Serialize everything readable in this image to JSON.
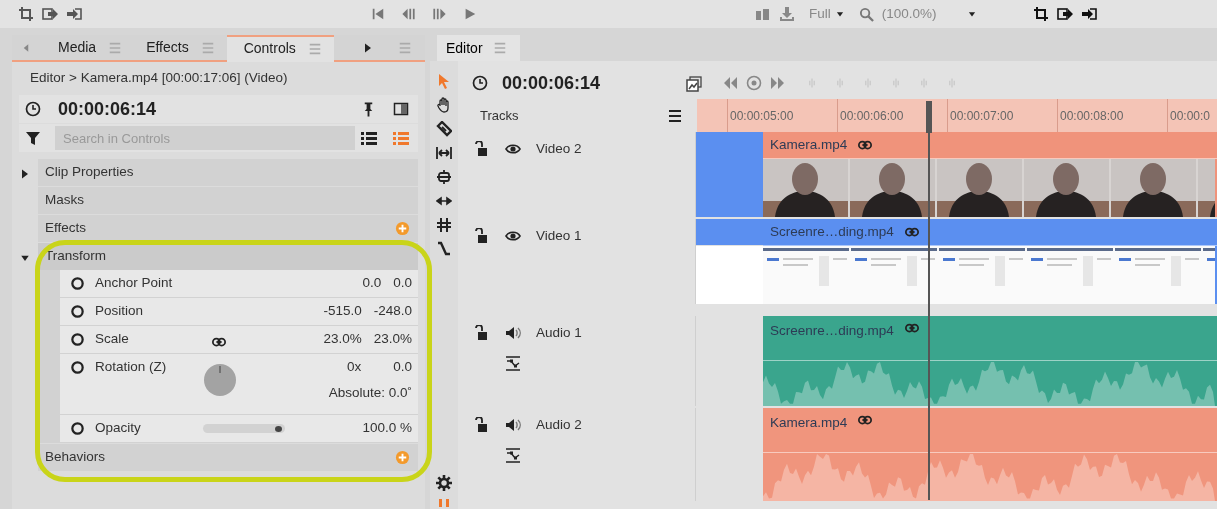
{
  "top_toolbar": {
    "quality": "Full",
    "zoom": "(100.0%)"
  },
  "panel_tabs": [
    {
      "label": "Media",
      "selected": false
    },
    {
      "label": "Effects",
      "selected": false
    },
    {
      "label": "Controls",
      "selected": true
    }
  ],
  "breadcrumb": "Editor > Kamera.mp4 [00:00:17:06] (Video)",
  "controls_time": "00:00:06:14",
  "search": {
    "placeholder": "Search in Controls"
  },
  "view_buttons": [
    {
      "selected": false
    },
    {
      "selected": true
    }
  ],
  "sections": [
    {
      "label": "Clip Properties",
      "kind": "group",
      "expanded": false,
      "add_button": false
    },
    {
      "label": "Masks",
      "kind": "item",
      "add_button": false
    },
    {
      "label": "Effects",
      "kind": "item",
      "add_button": true
    },
    {
      "label": "Transform",
      "kind": "group",
      "expanded": true,
      "add_button": false,
      "params": [
        {
          "label": "Anchor Point",
          "kind": "pair",
          "values": [
            "0.0",
            "0.0"
          ]
        },
        {
          "label": "Position",
          "kind": "pair",
          "values": [
            "-515.0",
            "-248.0"
          ]
        },
        {
          "label": "Scale",
          "kind": "pair",
          "linked": true,
          "values": [
            "23.0%",
            "23.0%"
          ]
        },
        {
          "label": "Rotation (Z)",
          "kind": "dial",
          "values": [
            "0x",
            "0.0"
          ],
          "absolute": "Absolute: 0.0˚"
        },
        {
          "label": "Opacity",
          "kind": "slider",
          "level": 1,
          "reading": "100.0 %"
        }
      ]
    },
    {
      "label": "Behaviors",
      "kind": "item",
      "add_button": true
    }
  ],
  "editor": {
    "tab": "Editor",
    "timecode": "00:00:06:14",
    "tracks_label": "Tracks",
    "ruler": [
      "00:00:05:00",
      "00:00:06:00",
      "00:00:07:00",
      "00:00:08:00",
      "00:00:0"
    ],
    "tracks": [
      {
        "name": "Video 2",
        "kind": "video",
        "lead": {
          "color": "#5b8ff0",
          "full": true
        },
        "clip": {
          "label": "Kamera.mp4",
          "kind": "camera",
          "color": "#f0937b"
        }
      },
      {
        "name": "Video 1",
        "kind": "video",
        "lead": {
          "color": "#5b8ff0",
          "full": false
        },
        "clip": {
          "label": "Screenre…ding.mp4",
          "kind": "screen",
          "color": "#5b8ff0"
        }
      },
      {
        "name": "Audio 1",
        "kind": "audio",
        "clip": {
          "label": "Screenre…ding.mp4",
          "kind": "waveform",
          "color": "#3aa58d"
        }
      },
      {
        "name": "Audio 2",
        "kind": "audio",
        "clip": {
          "label": "Kamera.mp4",
          "kind": "waveform",
          "color": "#f0957d"
        }
      }
    ]
  }
}
